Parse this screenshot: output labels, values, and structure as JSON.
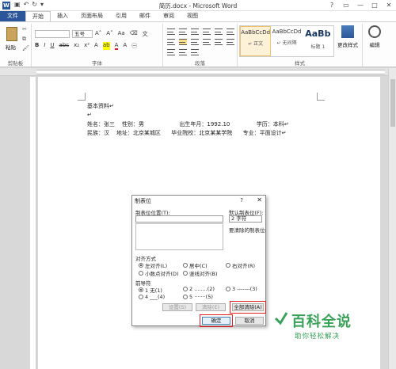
{
  "window": {
    "title": "简历.docx - Microsoft Word",
    "app_icon": "W",
    "help": "?",
    "quick_access": [
      "save-icon",
      "undo-icon",
      "redo-icon"
    ]
  },
  "tabs": [
    {
      "label": "文件",
      "type": "file"
    },
    {
      "label": "开始",
      "active": true
    },
    {
      "label": "插入"
    },
    {
      "label": "页面布局"
    },
    {
      "label": "引用"
    },
    {
      "label": "邮件"
    },
    {
      "label": "审阅"
    },
    {
      "label": "视图"
    }
  ],
  "ribbon": {
    "clipboard": {
      "paste_label": "粘贴",
      "group_label": "剪贴板"
    },
    "font": {
      "name": "",
      "size": "五号",
      "group_label": "字体"
    },
    "paragraph": {
      "group_label": "段落"
    },
    "styles": {
      "items": [
        {
          "sample": "AaBbCcDd",
          "name": "↵ 正文",
          "selected": true
        },
        {
          "sample": "AaBbCcDd",
          "name": "↵ 无间隔"
        },
        {
          "sample": "AaBb",
          "name": "标题 1"
        }
      ],
      "change_styles": "更改样式",
      "group_label": "样式"
    },
    "editing": {
      "label": "编辑"
    }
  },
  "document": {
    "lines": [
      "基本资料↵",
      "↵",
      "姓名：张三    性别：男                    出生年月：1992.10               学历：本科↵",
      "民族：汉    地址：北京某城区      毕业院校：北京某某学院      专业：平面设计↵"
    ]
  },
  "dialog": {
    "title": "制表位",
    "help": "?",
    "close": "✕",
    "tab_stop_position_label": "制表位位置(T):",
    "tab_stop_position_value": "",
    "default_tab_label": "默认制表位(F):",
    "default_tab_value": "2 字符",
    "to_clear_label": "要清除的制表位:",
    "alignment_label": "对齐方式",
    "alignment": [
      {
        "label": "左对齐(L)",
        "checked": true
      },
      {
        "label": "居中(C)"
      },
      {
        "label": "右对齐(R)"
      },
      {
        "label": "小数点对齐(D)"
      },
      {
        "label": "竖线对齐(B)"
      }
    ],
    "leader_label": "前导符",
    "leaders": [
      {
        "label": "1 无(1)",
        "checked": true
      },
      {
        "label": "2 ........(2)"
      },
      {
        "label": "3 -------(3)"
      },
      {
        "label": "4 ___(4)"
      },
      {
        "label": "5 ·······(5)"
      }
    ],
    "buttons": {
      "set": "设置(S)",
      "clear": "清除(E)",
      "clear_all": "全部清除(A)",
      "ok": "确定",
      "cancel": "取消"
    }
  },
  "watermark": {
    "title": "百科全说",
    "subtitle": "助你轻松解决"
  }
}
